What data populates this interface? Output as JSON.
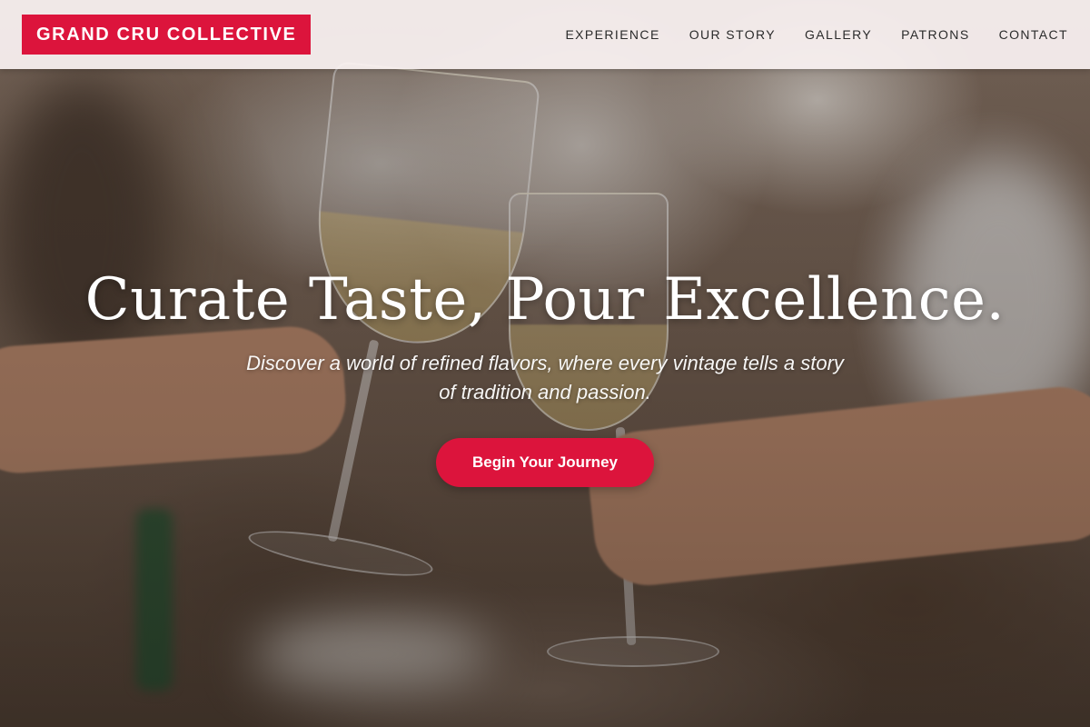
{
  "header": {
    "logo": "GRAND CRU COLLECTIVE",
    "nav": [
      "EXPERIENCE",
      "OUR STORY",
      "GALLERY",
      "PATRONS",
      "CONTACT"
    ]
  },
  "hero": {
    "headline": "Curate Taste, Pour Excellence.",
    "subtitle": "Discover a world of refined flavors, where every vintage tells a story of tradition and passion.",
    "cta_label": "Begin Your Journey",
    "background": "blurred-photo-of-hands-toasting-white-wine-glasses"
  },
  "colors": {
    "accent": "#dc143c",
    "header_bg": "#faf2f2",
    "nav_text": "#2b2b2b",
    "hero_text": "#ffffff"
  }
}
